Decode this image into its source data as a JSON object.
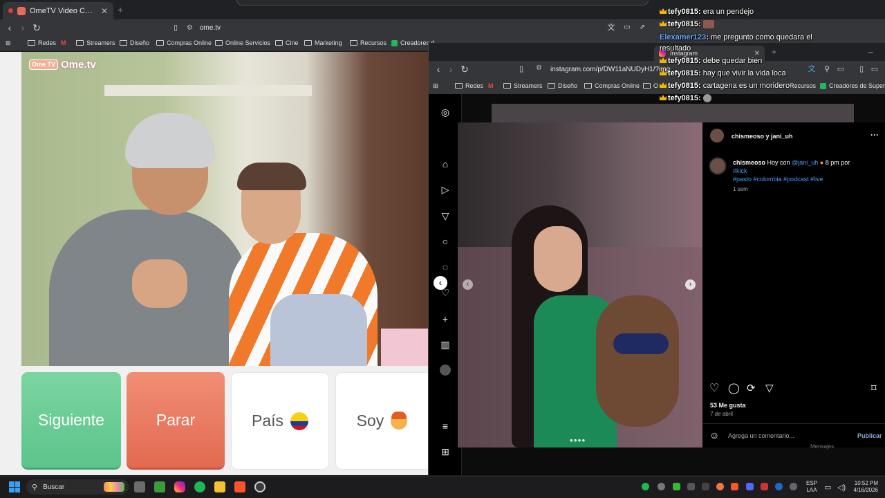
{
  "browser": {
    "tab_title": "OmeTV Video Chat — Omeg",
    "tab_close": "✕",
    "new_tab": "+",
    "url": "ome.tv",
    "bookmarks": [
      "Redes",
      "M",
      "Streamers",
      "Diseño",
      "Compras Online",
      "Online Servicios",
      "Cine",
      "Marketing",
      "Recursos",
      "Creadores d"
    ]
  },
  "ome": {
    "logo_badge": "Ome TV",
    "logo_text": "Ome.tv",
    "next_label": "Siguiente",
    "stop_label": "Parar",
    "country_label": "País",
    "soy_label": "Soy"
  },
  "browser2": {
    "tab_title": "Instagram",
    "new_tab": "+",
    "url": "instagram.com/p/DW11aNUDyH1/?img",
    "bookmarks": [
      "Redes",
      "M",
      "Streamers",
      "Diseño",
      "Compras Online",
      "O"
    ],
    "bookmarks_right": [
      "Recursos",
      "Creadores de Super..."
    ]
  },
  "instagram": {
    "header_user": "chismeoso y jani_uh",
    "caption_user": "chismeoso",
    "caption_text": "Hoy con",
    "caption_mention": "@jani_uh",
    "caption_suffix": "8 pm por",
    "caption_tags_1": "#kick",
    "caption_tags_2": "#pasto #colombia #podcast #live",
    "caption_time": "1 sem",
    "likes": "53 Me gusta",
    "date": "7 de abril",
    "comment_placeholder": "Agrega un comentario...",
    "publish": "Publicar",
    "more": "···",
    "messages": "Mensajes"
  },
  "chat": [
    {
      "user": "tefy0815",
      "msg": "era un pendejo",
      "color": "#ffffff"
    },
    {
      "user": "tefy0815",
      "msg": "",
      "color": "#ffffff"
    },
    {
      "user": "Elexamer123",
      "msg": "me pregunto como quedara el",
      "color": "#6aa8ff"
    },
    {
      "user": "",
      "msg": "resultado",
      "color": "#ffffff"
    },
    {
      "user": "tefy0815",
      "msg": "debe quedar bien",
      "color": "#ffffff"
    },
    {
      "user": "tefy0815",
      "msg": "hay que vivir la vida loca",
      "color": "#ffffff"
    },
    {
      "user": "tefy0815",
      "msg": "cartagena es un moridero",
      "color": "#ffffff"
    },
    {
      "user": "tefy0815",
      "msg": "",
      "color": "#ffffff"
    }
  ],
  "taskbar": {
    "search": "Buscar",
    "lang_1": "ESP",
    "lang_2": "LAA",
    "time": "10:52 PM",
    "date": "4/16/2026"
  }
}
